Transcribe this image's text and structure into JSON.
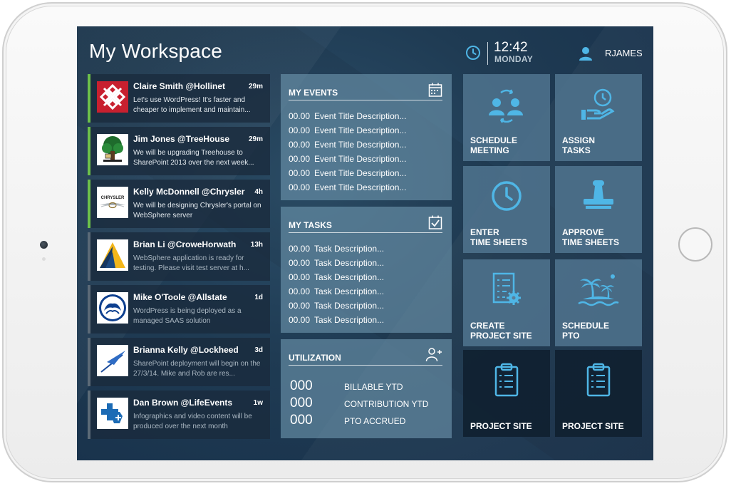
{
  "header": {
    "title": "My Workspace",
    "time": "12:42",
    "day": "MONDAY",
    "username": "RJAMES"
  },
  "feed": [
    {
      "name": "Claire Smith @Hollinet",
      "time": "29m",
      "text": "Let's use WordPress!  It's faster and cheaper to implement and maintain...",
      "logo": "hollinet-logo",
      "active": true
    },
    {
      "name": "Jim Jones @TreeHouse",
      "time": "29m",
      "text": "We will be upgrading Treehouse to SharePoint 2013 over the next week...",
      "logo": "treehouse-logo",
      "active": true
    },
    {
      "name": "Kelly McDonnell @Chrysler",
      "time": "4h",
      "text": "We will be designing Chrysler's portal on WebSphere server",
      "logo": "chrysler-logo",
      "logo_text": "CHRYSLER",
      "active": true
    },
    {
      "name": "Brian Li @CroweHorwath",
      "time": "13h",
      "text": "WebSphere application is ready for testing.  Please visit test server at h...",
      "logo": "crowe-horwath-logo",
      "active": false
    },
    {
      "name": "Mike O'Toole @Allstate",
      "time": "1d",
      "text": "WordPress is being deployed as a managed SAAS solution",
      "logo": "allstate-logo",
      "active": false
    },
    {
      "name": "Brianna Kelly @Lockheed",
      "time": "3d",
      "text": "SharePoint deployment will begin on the 27/3/14.  Mike and Rob are res...",
      "logo": "lockheed-logo",
      "active": false
    },
    {
      "name": "Dan Brown @LifeEvents",
      "time": "1w",
      "text": "Infographics and video content will be produced over the next month",
      "logo": "blue-cross-logo",
      "active": false
    }
  ],
  "events": {
    "title": "MY EVENTS",
    "icon": "calendar-icon",
    "items": [
      {
        "num": "00.00",
        "text": "Event Title Description..."
      },
      {
        "num": "00.00",
        "text": "Event Title Description..."
      },
      {
        "num": "00.00",
        "text": "Event Title Description..."
      },
      {
        "num": "00.00",
        "text": "Event Title Description..."
      },
      {
        "num": "00.00",
        "text": "Event Title Description..."
      },
      {
        "num": "00.00",
        "text": "Event Title Description..."
      }
    ]
  },
  "tasks": {
    "title": "MY TASKS",
    "icon": "checkbox-icon",
    "items": [
      {
        "num": "00.00",
        "text": "Task Description..."
      },
      {
        "num": "00.00",
        "text": "Task Description..."
      },
      {
        "num": "00.00",
        "text": "Task Description..."
      },
      {
        "num": "00.00",
        "text": "Task Description..."
      },
      {
        "num": "00.00",
        "text": "Task Description..."
      },
      {
        "num": "00.00",
        "text": "Task Description..."
      }
    ]
  },
  "utilization": {
    "title": "UTILIZATION",
    "icon": "add-user-icon",
    "rows": [
      {
        "value": "000",
        "label": "BILLABLE YTD"
      },
      {
        "value": "000",
        "label": "CONTRIBUTION YTD"
      },
      {
        "value": "000",
        "label": "PTO ACCRUED"
      }
    ]
  },
  "tiles": [
    {
      "line1": "SCHEDULE",
      "line2": "MEETING",
      "icon": "meeting-icon"
    },
    {
      "line1": "ASSIGN",
      "line2": "TASKS",
      "icon": "hand-clock-icon"
    },
    {
      "line1": "ENTER",
      "line2": "TIME SHEETS",
      "icon": "clock-icon"
    },
    {
      "line1": "APPROVE",
      "line2": "TIME SHEETS",
      "icon": "stamp-icon"
    },
    {
      "line1": "CREATE",
      "line2": "PROJECT SITE",
      "icon": "document-gear-icon"
    },
    {
      "line1": "SCHEDULE",
      "line2": "PTO",
      "icon": "palm-island-icon"
    },
    {
      "line1": "PROJECT SITE",
      "line2": "",
      "icon": "clipboard-icon"
    },
    {
      "line1": "PROJECT SITE",
      "line2": "",
      "icon": "clipboard-icon"
    }
  ],
  "colors": {
    "accent": "#4fb6e6",
    "active_bar": "#6dc04a",
    "inactive_bar": "#5b6a77"
  }
}
